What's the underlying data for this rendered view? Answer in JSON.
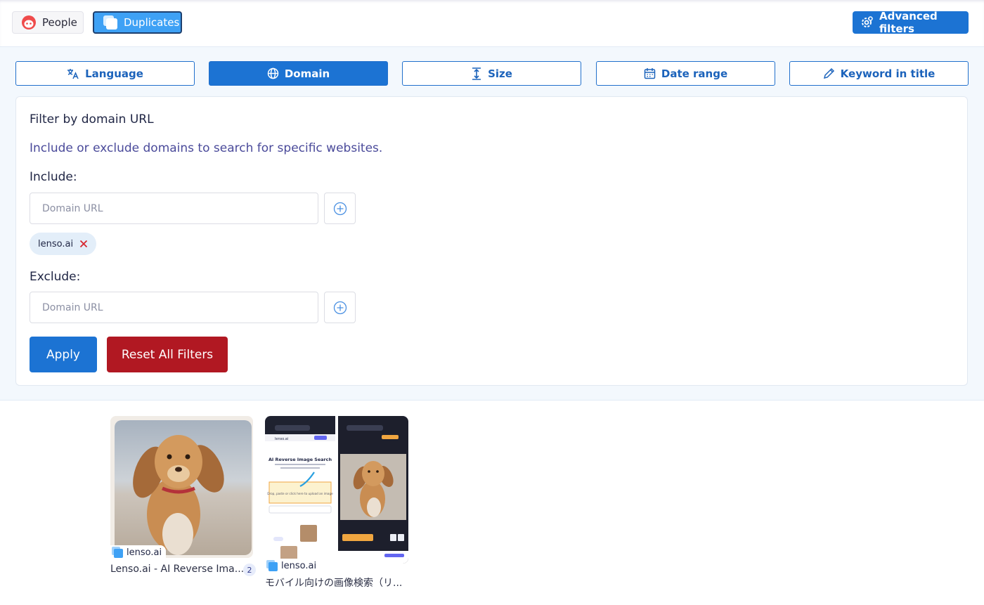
{
  "top": {
    "people_label": "People",
    "duplicates_label": "Duplicates",
    "advanced_label": "Advanced filters"
  },
  "tabs": [
    {
      "label": "Language",
      "icon": "translate-icon",
      "active": false
    },
    {
      "label": "Domain",
      "icon": "globe-icon",
      "active": true
    },
    {
      "label": "Size",
      "icon": "vertical-resize-icon",
      "active": false
    },
    {
      "label": "Date range",
      "icon": "calendar-icon",
      "active": false
    },
    {
      "label": "Keyword in title",
      "icon": "pencil-icon",
      "active": false
    }
  ],
  "domain_filter": {
    "title": "Filter by domain URL",
    "description": "Include or exclude domains to search for specific websites.",
    "include_label": "Include:",
    "include_placeholder": "Domain URL",
    "include_value": "",
    "included_domains": [
      "lenso.ai"
    ],
    "exclude_label": "Exclude:",
    "exclude_placeholder": "Domain URL",
    "exclude_value": ""
  },
  "actions": {
    "apply_label": "Apply",
    "reset_label": "Reset All Filters"
  },
  "results": [
    {
      "source": "lenso.ai",
      "title": "Lenso.ai - AI Reverse Ima...",
      "count": "2"
    },
    {
      "source": "lenso.ai",
      "title": "モバイル向けの画像検索（リ..."
    }
  ],
  "mock_phone": {
    "brand": "lenso.ai",
    "heading": "AI Reverse Image Search",
    "upload_hint": "Drop, paste or click here to upload an image"
  },
  "colors": {
    "primary": "#1c73d3",
    "danger": "#b11822",
    "duplicates": "#3ea1f5",
    "panel_bg": "#f3f8fd"
  }
}
